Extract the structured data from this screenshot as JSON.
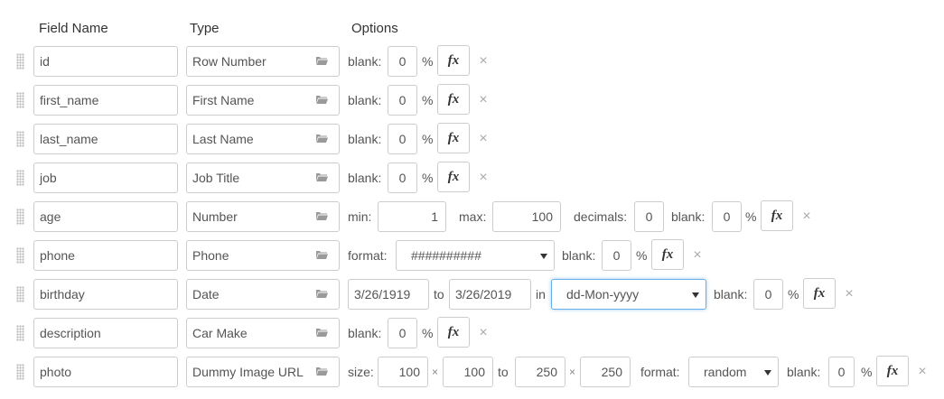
{
  "headers": {
    "field_name": "Field Name",
    "type": "Type",
    "options": "Options"
  },
  "labels": {
    "blank": "blank:",
    "percent": "%",
    "fx": "fx",
    "close": "×",
    "min": "min:",
    "max": "max:",
    "decimals": "decimals:",
    "format": "format:",
    "to": "to",
    "in": "in",
    "size": "size:",
    "times": "×"
  },
  "icons": {
    "drag": "drag-handle-icon",
    "type": "folder-open-icon",
    "fx": "function-icon",
    "remove": "close-icon",
    "dropdown": "chevron-down-icon"
  },
  "rows": [
    {
      "field_name": "id",
      "type": "Row Number",
      "blank": "0"
    },
    {
      "field_name": "first_name",
      "type": "First Name",
      "blank": "0"
    },
    {
      "field_name": "last_name",
      "type": "Last Name",
      "blank": "0"
    },
    {
      "field_name": "job",
      "type": "Job Title",
      "blank": "0"
    },
    {
      "field_name": "age",
      "type": "Number",
      "min": "1",
      "max": "100",
      "decimals": "0",
      "blank": "0"
    },
    {
      "field_name": "phone",
      "type": "Phone",
      "format": "##########",
      "blank": "0"
    },
    {
      "field_name": "birthday",
      "type": "Date",
      "from": "3/26/1919",
      "to": "3/26/2019",
      "format": "dd-Mon-yyyy",
      "blank": "0"
    },
    {
      "field_name": "description",
      "type": "Car Make",
      "blank": "0"
    },
    {
      "field_name": "photo",
      "type": "Dummy Image URL",
      "width_min": "100",
      "height_min": "100",
      "width_max": "250",
      "height_max": "250",
      "format": "random",
      "blank": "0"
    }
  ]
}
